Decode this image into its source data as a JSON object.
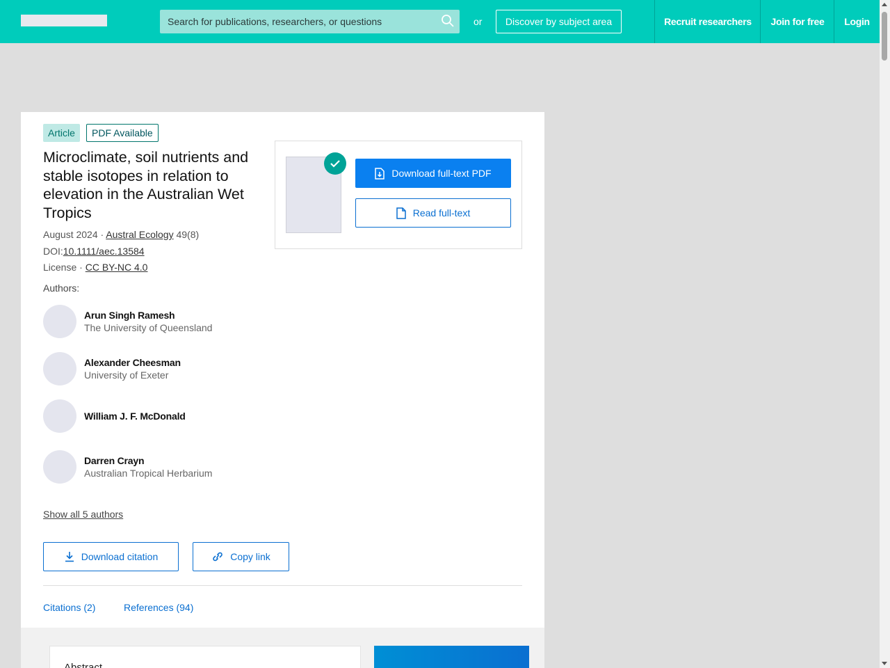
{
  "header": {
    "search_placeholder": "Search for publications, researchers, or questions",
    "or_text": "or",
    "discover_label": "Discover by subject area",
    "nav": {
      "recruit": "Recruit researchers",
      "join": "Join for free",
      "login": "Login"
    },
    "accent_color": "#00ccbb"
  },
  "article": {
    "type_badge": "Article",
    "pdf_badge": "PDF Available",
    "title": "Microclimate, soil nutrients and stable isotopes in relation to elevation in the Australian Wet Tropics",
    "date": "August 2024 · ",
    "journal": "Austral Ecology",
    "volume": " 49(8)",
    "doi_label": "DOI:",
    "doi": "10.1111/aec.13584",
    "license_label": "License · ",
    "license": "CC BY-NC 4.0",
    "authors_label": "Authors:",
    "authors": [
      {
        "name": "Arun Singh Ramesh",
        "institution": "The University of Queensland"
      },
      {
        "name": "Alexander Cheesman",
        "institution": "University of Exeter"
      },
      {
        "name": "William J. F. McDonald",
        "institution": ""
      },
      {
        "name": "Darren Crayn",
        "institution": "Australian Tropical Herbarium"
      }
    ],
    "show_all": "Show all 5 authors"
  },
  "actions": {
    "download_citation": "Download citation",
    "copy_link": "Copy link",
    "download_pdf": "Download full-text PDF",
    "read_fulltext": "Read full-text"
  },
  "tabs": {
    "citations": "Citations (2)",
    "references": "References (94)"
  },
  "abstract": {
    "title": "Abstract"
  }
}
